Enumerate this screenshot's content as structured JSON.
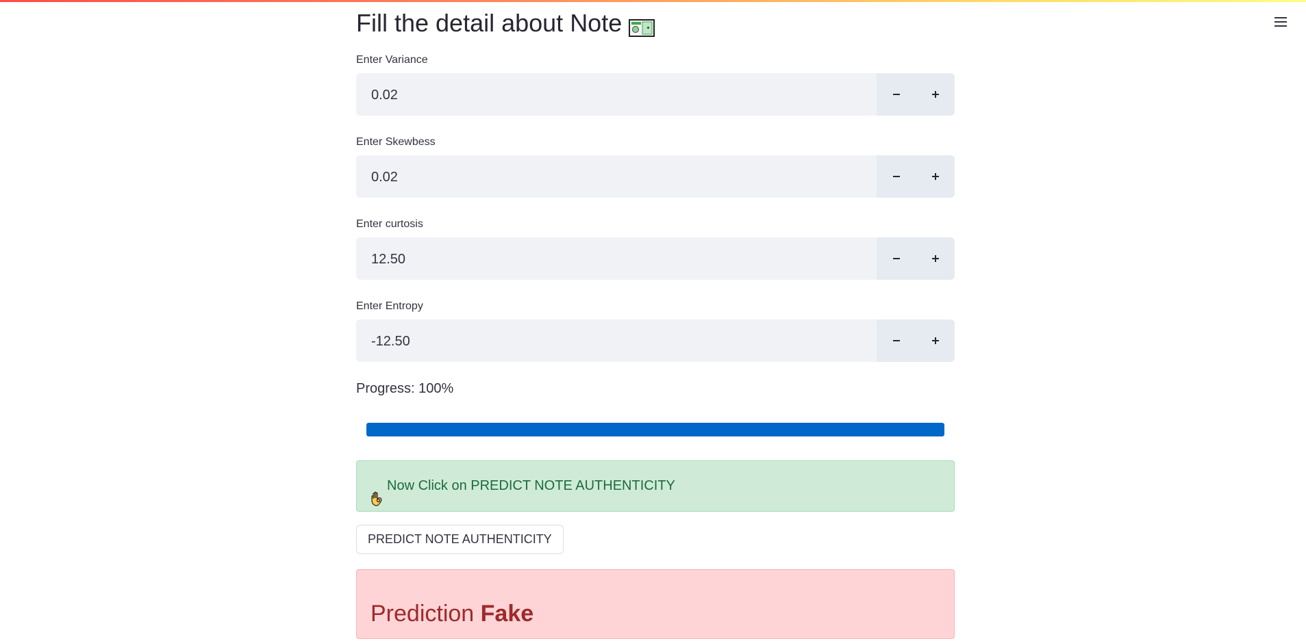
{
  "header": {
    "title": "Fill the detail about Note",
    "title_icon": "banknote-icon",
    "menu_icon": "hamburger-menu-icon",
    "accent_gradient": [
      "#ff4b4b",
      "#ffd866",
      "#fffd80"
    ]
  },
  "fields": [
    {
      "label": "Enter Variance",
      "value": "0.02"
    },
    {
      "label": "Enter Skewbess",
      "value": "0.02"
    },
    {
      "label": "Enter curtosis",
      "value": "12.50"
    },
    {
      "label": "Enter Entropy",
      "value": "-12.50"
    }
  ],
  "stepper": {
    "minus_icon": "minus-icon",
    "plus_icon": "plus-icon"
  },
  "progress": {
    "label": "Progress: 100%",
    "value": 1.0,
    "color": "#0068c9"
  },
  "success_alert": {
    "icon": "ok-hand-icon",
    "text": "Now Click on PREDICT NOTE AUTHENTICITY",
    "color": "#1d6b39"
  },
  "predict_button": {
    "label": "PREDICT NOTE AUTHENTICITY"
  },
  "error_alert": {
    "prefix": "Prediction",
    "result": "Fake",
    "color": "#9e2a2b"
  }
}
